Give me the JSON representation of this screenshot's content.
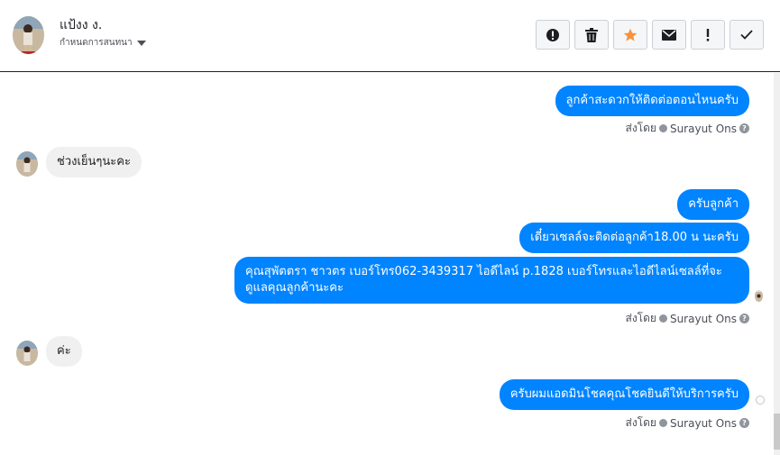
{
  "header": {
    "contact_name": "แป้งง ง.",
    "conversation_label": "กำหนดการสนทนา",
    "actions": [
      {
        "name": "report-button",
        "icon": "alert-circle-icon"
      },
      {
        "name": "delete-button",
        "icon": "trash-icon"
      },
      {
        "name": "star-button",
        "icon": "star-icon",
        "color": "#f7923b"
      },
      {
        "name": "mail-button",
        "icon": "envelope-icon"
      },
      {
        "name": "mark-important-button",
        "icon": "exclamation-icon"
      },
      {
        "name": "done-button",
        "icon": "check-icon"
      }
    ]
  },
  "thread": {
    "sent_by_prefix": "ส่งโดย",
    "messages": [
      {
        "direction": "out",
        "text": "ลูกค้าสะดวกให้ติดต่อตอนไหนครับ"
      },
      {
        "direction": "in",
        "text": "ช่วงเย็นๆนะคะ"
      },
      {
        "direction": "out",
        "text": "ครับลูกค้า"
      },
      {
        "direction": "out",
        "text": "เดี๋ยวเซลล์จะติดต่อลูกค้า18.00 น นะครับ"
      },
      {
        "direction": "out",
        "text": "คุณสุพัตตรา  ชาวตร เบอร์โทร062-3439317 ไอดีไลน์ p.1828  เบอร์โทรและไอดีไลน์เซลล์ที่จะดูแลคุณลูกค้านะคะ"
      },
      {
        "direction": "in",
        "text": "ค่ะ"
      },
      {
        "direction": "out",
        "text": "ครับผมแอดมินโชคคุณโชคยินดีให้บริการครับ"
      }
    ],
    "sent_by": [
      {
        "sender": "Surayut Ons"
      },
      {
        "sender": "Surayut Ons"
      },
      {
        "sender": "Surayut Ons"
      }
    ]
  },
  "colors": {
    "outgoing_bubble": "#0084ff",
    "incoming_bubble": "#f1f0f0",
    "star": "#f7923b"
  }
}
